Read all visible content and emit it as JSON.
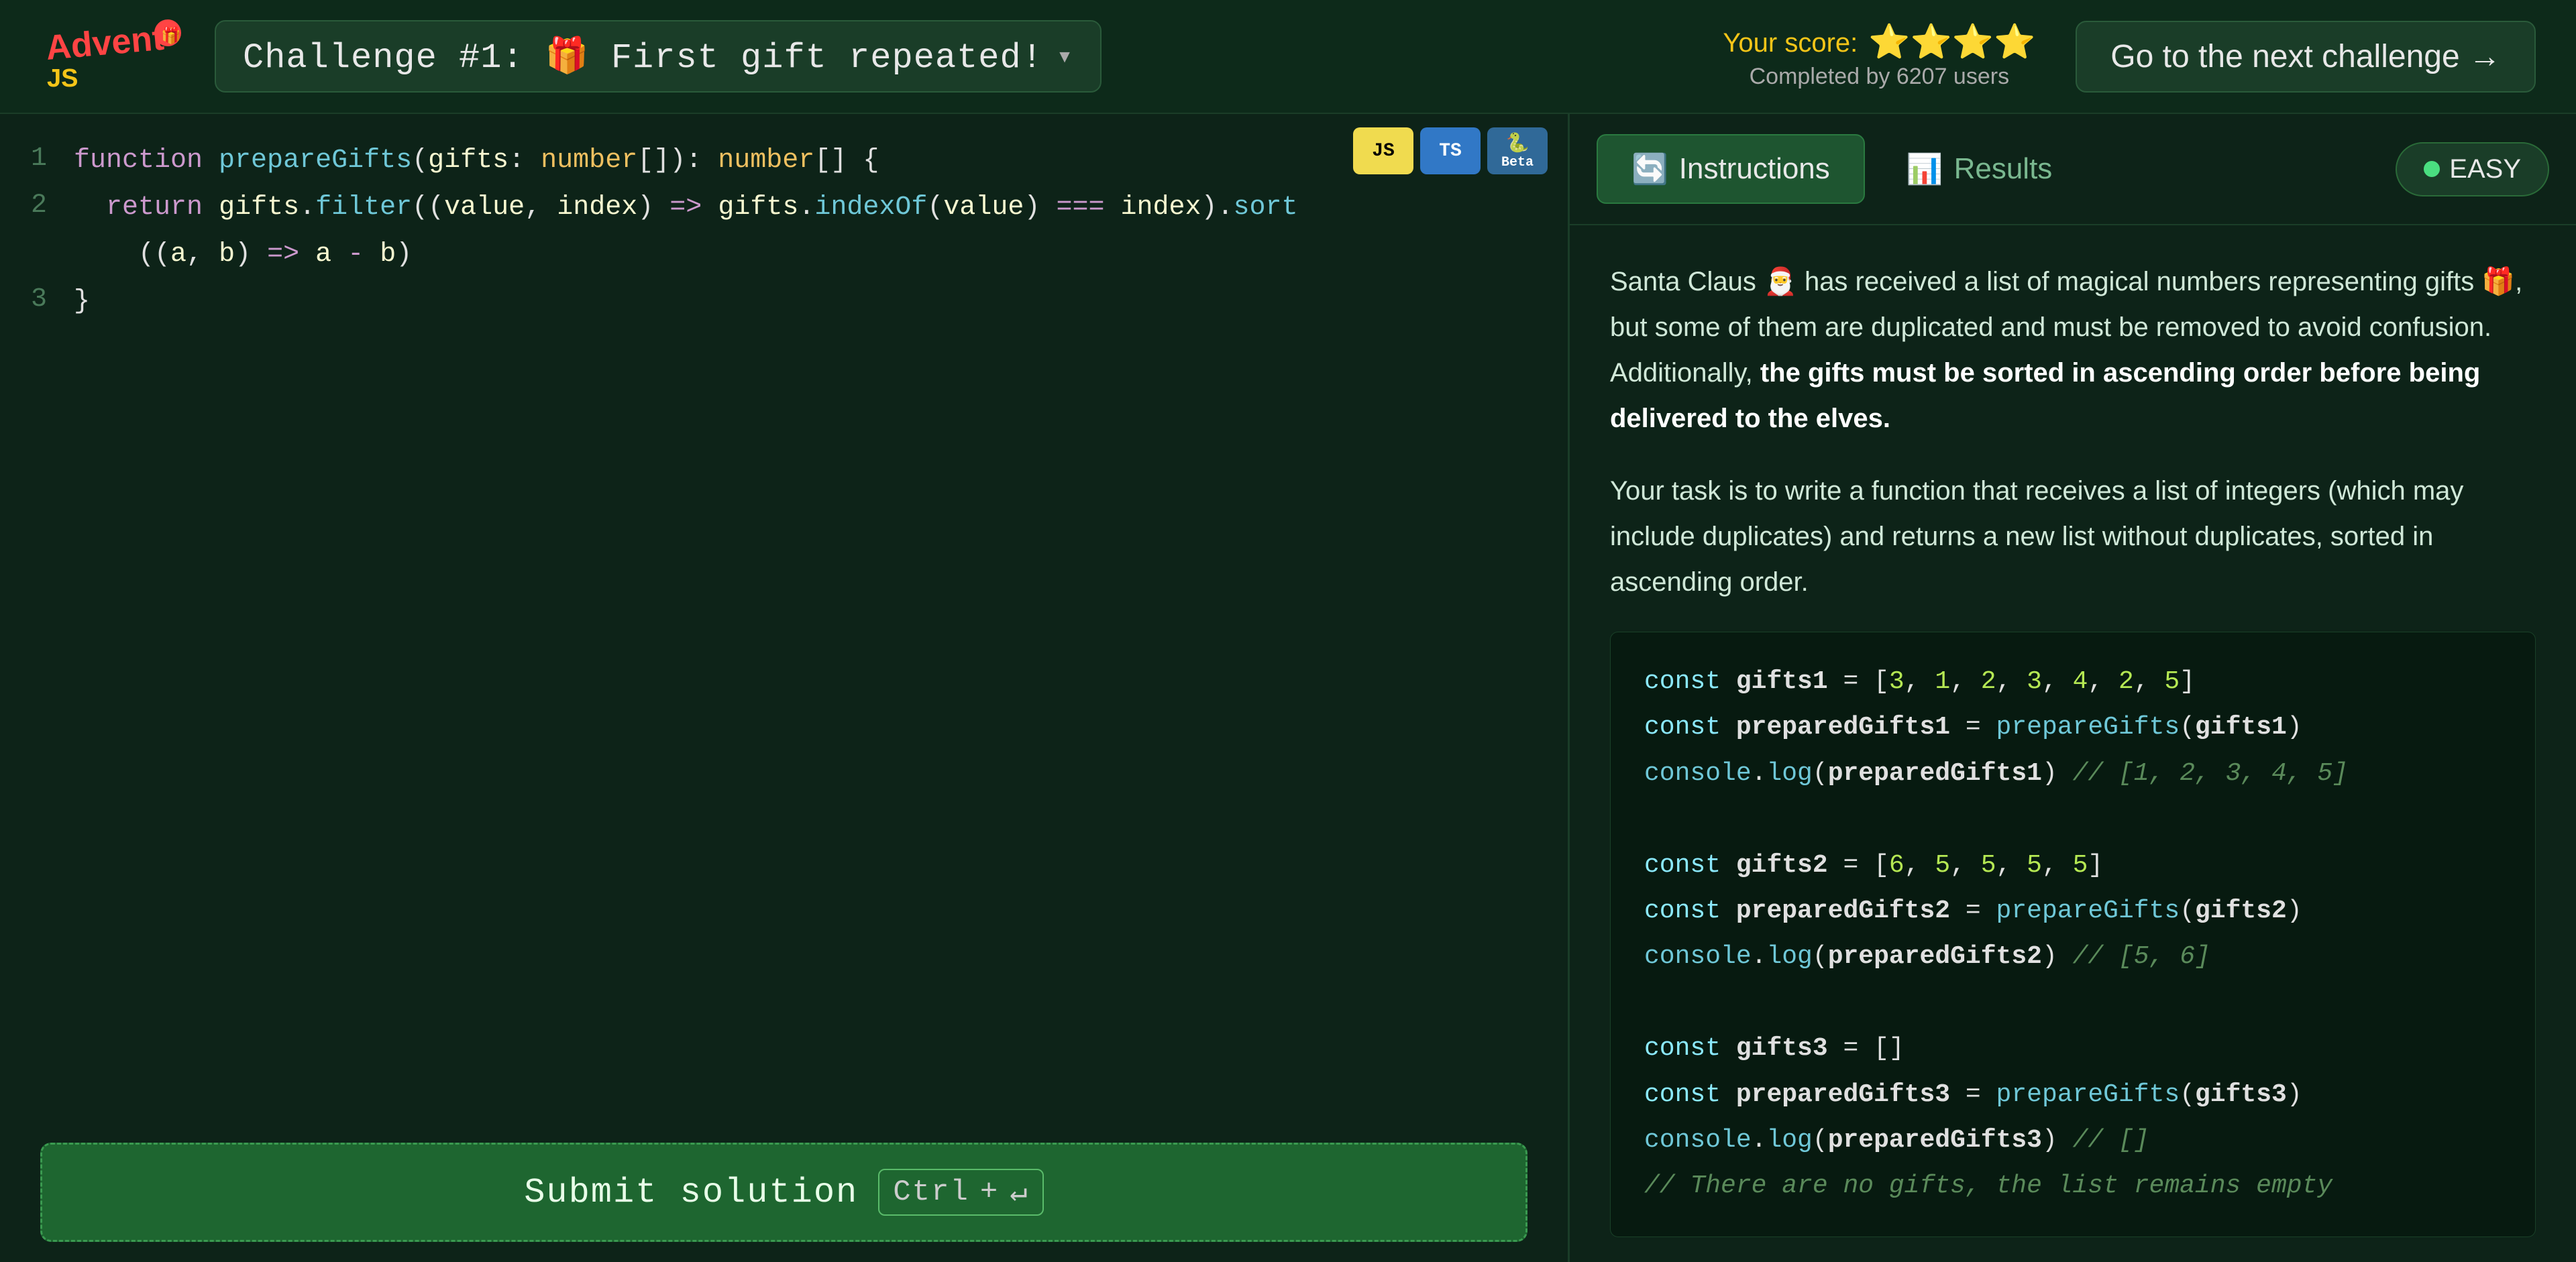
{
  "header": {
    "logo_text": "Advent JS",
    "challenge_title": "Challenge #1: 🎁 First gift repeated!",
    "score_label": "Your score:",
    "stars": "⭐⭐⭐⭐",
    "completed_text": "Completed by 6207 users",
    "next_button_label": "Go to the next challenge →"
  },
  "editor": {
    "lang_buttons": [
      "JS",
      "TS",
      "Beta"
    ],
    "code_lines": [
      {
        "number": "1",
        "content": "function prepareGifts(gifts: number[]): number[] {"
      },
      {
        "number": "2",
        "content": "  return gifts.filter((value, index) => gifts.indexOf(value) === index).sort"
      },
      {
        "number": "",
        "content": "    ((a, b) => a - b)"
      },
      {
        "number": "3",
        "content": "}"
      }
    ],
    "submit_label": "Submit solution",
    "shortcut_ctrl": "Ctrl",
    "shortcut_enter": "↵"
  },
  "panel": {
    "instructions_tab": "Instructions",
    "results_tab": "Results",
    "difficulty": "EASY",
    "description_1": "Santa Claus 🎅 has received a list of magical numbers representing gifts 🎁, but some of them are duplicated and must be removed to avoid confusion. Additionally,",
    "description_bold": "the gifts must be sorted in ascending order before being delivered to the elves.",
    "description_2": "Your task is to write a function that receives a list of integers (which may include duplicates) and returns a new list without duplicates, sorted in ascending order.",
    "code_example": {
      "lines": [
        {
          "text": "const gifts1 = [3, 1, 2, 3, 4, 2, 5]",
          "type": "normal"
        },
        {
          "text": "const preparedGifts1 = prepareGifts(gifts1)",
          "type": "normal"
        },
        {
          "text": "console.log(preparedGifts1) // [1, 2, 3, 4, 5]",
          "type": "comment-inline"
        },
        {
          "text": "",
          "type": "blank"
        },
        {
          "text": "const gifts2 = [6, 5, 5, 5, 5]",
          "type": "normal"
        },
        {
          "text": "const preparedGifts2 = prepareGifts(gifts2)",
          "type": "normal"
        },
        {
          "text": "console.log(preparedGifts2) // [5, 6]",
          "type": "comment-inline"
        },
        {
          "text": "",
          "type": "blank"
        },
        {
          "text": "const gifts3 = []",
          "type": "normal"
        },
        {
          "text": "const preparedGifts3 = prepareGifts(gifts3)",
          "type": "normal"
        },
        {
          "text": "console.log(preparedGifts3) // []",
          "type": "comment-inline"
        },
        {
          "text": "// There are no gifts, the list remains empty",
          "type": "comment-only"
        }
      ]
    }
  }
}
